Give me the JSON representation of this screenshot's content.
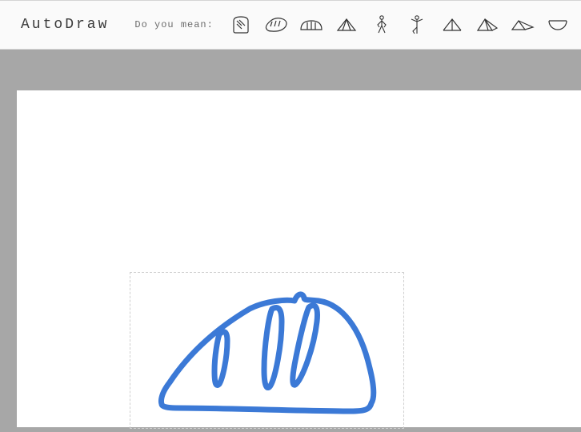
{
  "header": {
    "app_title": "AutoDraw",
    "prompt": "Do you mean:"
  },
  "suggestions": [
    {
      "name": "bread-slice-icon"
    },
    {
      "name": "baguette-icon"
    },
    {
      "name": "bread-loaf-icon"
    },
    {
      "name": "tent-a-icon"
    },
    {
      "name": "yoga-pose-icon"
    },
    {
      "name": "yoga-standing-icon"
    },
    {
      "name": "tent-b-icon"
    },
    {
      "name": "tent-c-icon"
    },
    {
      "name": "tent-d-icon"
    },
    {
      "name": "watermelon-slice-icon"
    },
    {
      "name": "onion-icon"
    }
  ],
  "canvas": {
    "stroke_color": "#3b79d6"
  }
}
